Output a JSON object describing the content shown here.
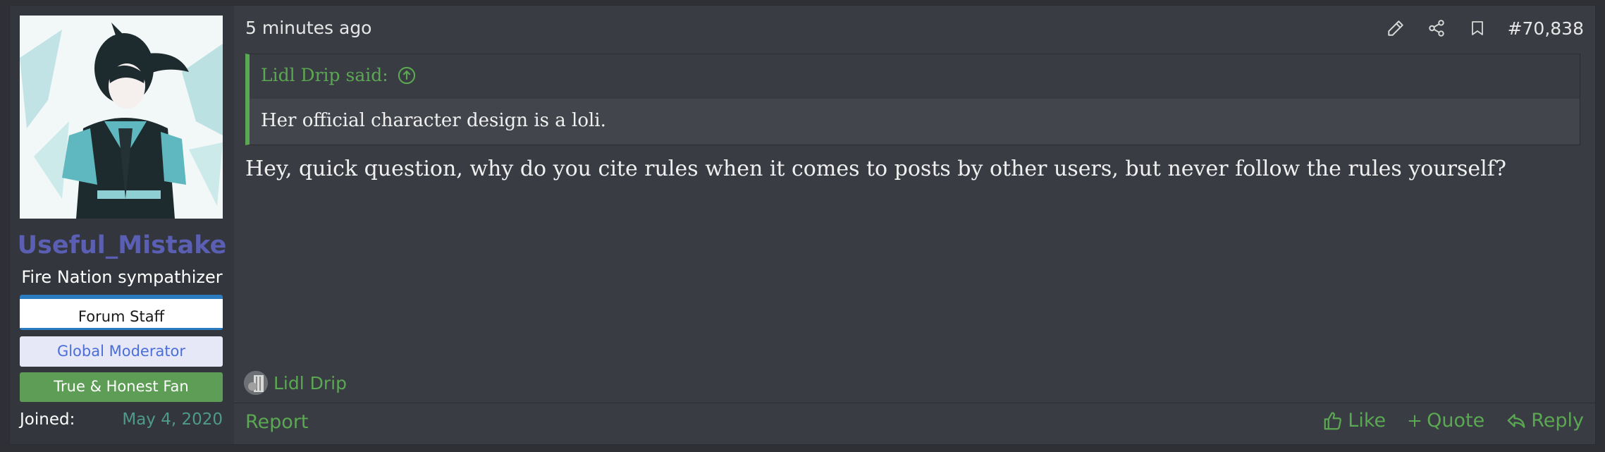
{
  "author": {
    "username": "Useful_Mistake",
    "title": "Fire Nation sympathizer",
    "banners": {
      "staff": "Forum Staff",
      "moderator": "Global Moderator",
      "fan": "True & Honest Fan"
    },
    "joined_label": "Joined:",
    "joined_date": "May 4, 2020"
  },
  "post": {
    "timestamp": "5 minutes ago",
    "number": "#70,838",
    "quote": {
      "author": "Lidl Drip said:",
      "text": "Her official character design is a loli."
    },
    "message": "Hey, quick question, why do you cite rules when it comes to posts by other users, but never follow the rules yourself?"
  },
  "reactions": {
    "user": "Lidl Drip"
  },
  "footer": {
    "report": "Report",
    "like": "Like",
    "quote": "Quote",
    "reply": "Reply"
  },
  "icons": {
    "edit": "pencil-icon",
    "share": "share-icon",
    "bookmark": "bookmark-icon",
    "quote_up": "arrow-up-circle-icon",
    "like": "thumbs-up-icon",
    "quote": "plus-icon",
    "reply": "reply-icon"
  },
  "colors": {
    "accent_green": "#5ba852",
    "username": "#5b5fb4",
    "background": "#393c43",
    "sidebar": "#33363c"
  }
}
